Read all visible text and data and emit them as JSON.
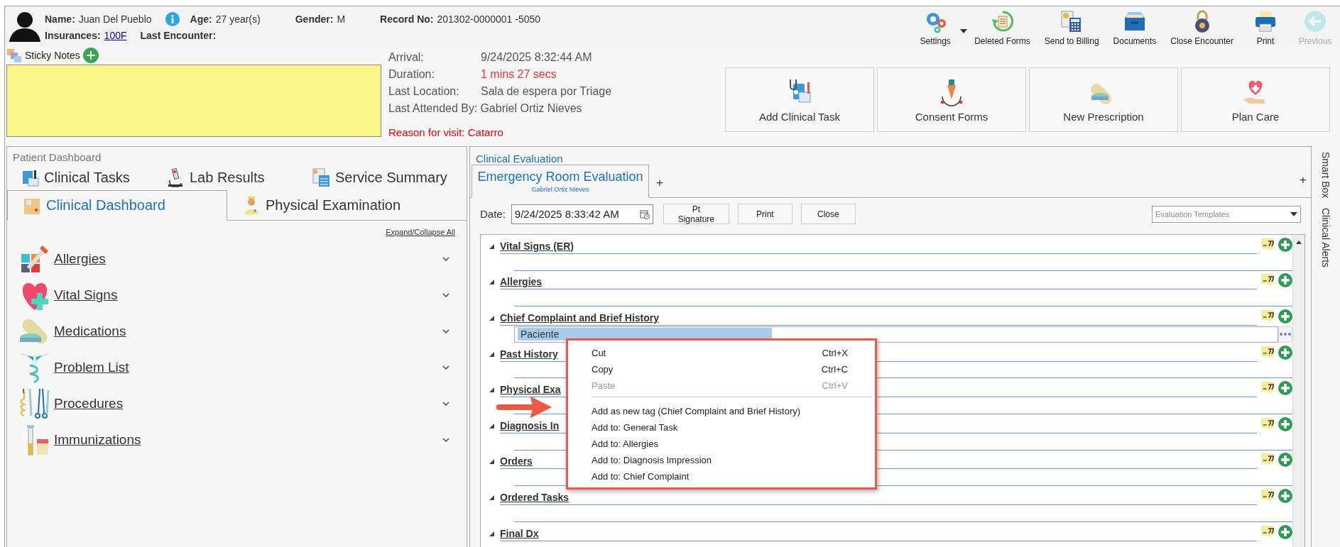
{
  "patient": {
    "name_label": "Name:",
    "name": "Juan Del Pueblo",
    "age_label": "Age:",
    "age": "27 year(s)",
    "gender_label": "Gender:",
    "gender": "M",
    "record_label": "Record No:",
    "record": "201302-0000001 -5050",
    "insurances_label": "Insurances:",
    "insurance": "100F",
    "last_encounter_label": "Last Encounter:"
  },
  "toolbar": [
    {
      "label": "Settings",
      "dropdown": true,
      "disabled": false
    },
    {
      "label": "Deleted Forms",
      "dropdown": false,
      "disabled": false
    },
    {
      "label": "Send to Billing",
      "dropdown": false,
      "disabled": false
    },
    {
      "label": "Documents",
      "dropdown": false,
      "disabled": false
    },
    {
      "label": "Close Encounter",
      "dropdown": false,
      "disabled": false
    },
    {
      "label": "Print",
      "dropdown": false,
      "disabled": false
    },
    {
      "label": "Previous",
      "dropdown": false,
      "disabled": true
    }
  ],
  "sticky_notes": {
    "title": "Sticky Notes"
  },
  "visit": [
    {
      "label": "Arrival:",
      "value": "9/24/2025 8:32:44 AM",
      "alert": false
    },
    {
      "label": "Duration:",
      "value": "1 mins 27 secs",
      "alert": true
    },
    {
      "label": "Last Location:",
      "value": "Sala de espera por Triage",
      "alert": false
    },
    {
      "label": "Last Attended By:",
      "value": "Gabriel Ortiz Nieves",
      "alert": false
    }
  ],
  "reason": "Reason for visit: Catarro",
  "actions": [
    "Add Clinical Task",
    "Consent Forms",
    "New Prescription",
    "Plan Care"
  ],
  "dashboard": {
    "title": "Patient Dashboard",
    "tab_rows": [
      [
        {
          "label": "Clinical Tasks",
          "selected": false
        },
        {
          "label": "Lab Results",
          "selected": false
        },
        {
          "label": "Service Summary",
          "selected": false
        }
      ],
      [
        {
          "label": "Clinical Dashboard",
          "selected": true
        },
        {
          "label": "Physical Examination",
          "selected": false
        }
      ]
    ],
    "expand_all": "Expand/Collapse All",
    "sections": [
      {
        "label": "Allergies",
        "expanded": false
      },
      {
        "label": "Vital Signs",
        "expanded": false
      },
      {
        "label": "Medications",
        "expanded": false
      },
      {
        "label": "Problem List",
        "expanded": false
      },
      {
        "label": "Procedures",
        "expanded": false
      },
      {
        "label": "Immunizations",
        "expanded": false
      }
    ]
  },
  "evaluation": {
    "title": "Clinical Evaluation",
    "tabs": [
      {
        "label": "Emergency Room Evaluation",
        "sublabel": "Gabriel Ortiz Nieves",
        "selected": true
      }
    ],
    "add_tab": "+",
    "add_panel": "+",
    "date_label": "Date:",
    "date": "9/24/2025 8:33:42 AM",
    "buttons": [
      "Pt Signature",
      "Print",
      "Close"
    ],
    "templates_placeholder": "Evaluation Templates",
    "sections": [
      {
        "title": "Vital Signs (ER)",
        "kind": "lines"
      },
      {
        "title": "Allergies",
        "kind": "lines"
      },
      {
        "title": "Chief Complaint and Brief History",
        "kind": "field",
        "value": "Paciente"
      },
      {
        "title": "Past History",
        "kind": "lines"
      },
      {
        "title": "Physical Exa",
        "kind": "lines"
      },
      {
        "title": "Diagnosis In",
        "kind": "lines"
      },
      {
        "title": "Orders",
        "kind": "lines"
      },
      {
        "title": "Ordered Tasks",
        "kind": "lines"
      },
      {
        "title": "Final Dx",
        "kind": "lines"
      }
    ]
  },
  "side_tabs": [
    "Smart Box",
    "Clinical Alerts"
  ],
  "context_menu": [
    {
      "kind": "item",
      "label": "Cut",
      "shortcut": "Ctrl+X",
      "disabled": false
    },
    {
      "kind": "item",
      "label": "Copy",
      "shortcut": "Ctrl+C",
      "disabled": false
    },
    {
      "kind": "item",
      "label": "Paste",
      "shortcut": "Ctrl+V",
      "disabled": true
    },
    {
      "kind": "separator"
    },
    {
      "kind": "item",
      "label": "Add as new tag (Chief Complaint and Brief History)",
      "disabled": false
    },
    {
      "kind": "item",
      "label": "Add to: General Task",
      "disabled": false
    },
    {
      "kind": "item",
      "label": "Add to: Allergies",
      "disabled": false
    },
    {
      "kind": "item",
      "label": "Add to: Diagnosis Impression",
      "disabled": false
    },
    {
      "kind": "item",
      "label": "Add to: Chief Complaint",
      "disabled": false
    }
  ]
}
